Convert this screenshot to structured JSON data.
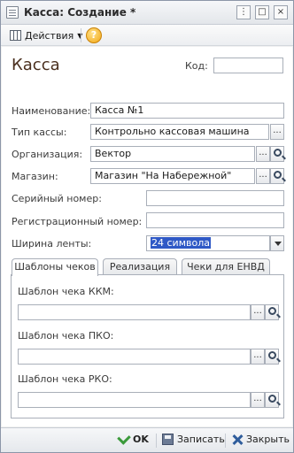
{
  "window": {
    "title": "Касса: Создание *",
    "close_glyph": "×",
    "max_glyph": "□",
    "menu_glyph": "⋮"
  },
  "toolbar": {
    "actions_label": "Действия",
    "help_glyph": "?"
  },
  "form": {
    "heading": "Касса",
    "code_label": "Код:",
    "code_value": "",
    "name_label": "Наименование:",
    "name_value": "Касса №1",
    "type_label": "Тип кассы:",
    "type_value": "Контрольно кассовая машина",
    "org_label": "Организация:",
    "org_value": "Вектор",
    "store_label": "Магазин:",
    "store_value": "Магазин \"На Набережной\"",
    "serial_label": "Серийный номер:",
    "serial_value": "",
    "reg_label": "Регистрационный номер:",
    "reg_value": "",
    "tape_label": "Ширина ленты:",
    "tape_value": "24 символа"
  },
  "tabs": [
    {
      "label": "Шаблоны чеков",
      "active": true
    },
    {
      "label": "Реализация",
      "active": false
    },
    {
      "label": "Чеки для ЕНВД",
      "active": false
    }
  ],
  "templates": {
    "kkm_label": "Шаблон чека ККМ:",
    "pko_label": "Шаблон чека ПКО:",
    "rko_label": "Шаблон чека РКО:"
  },
  "footer": {
    "ok_label": "OK",
    "save_label": "Записать",
    "close_label": "Закрыть"
  },
  "colors": {
    "heading": "#4a2f1e",
    "selection": "#2f59c6",
    "required_underline": "#e04040"
  }
}
